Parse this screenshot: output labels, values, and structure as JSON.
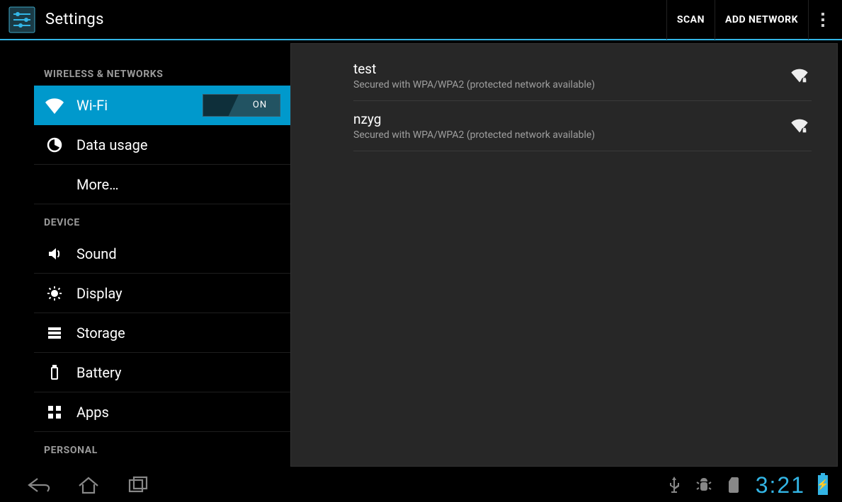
{
  "actionbar": {
    "title": "Settings",
    "scan": "SCAN",
    "add_network": "ADD NETWORK"
  },
  "sidebar": {
    "cat_wireless": "WIRELESS & NETWORKS",
    "cat_device": "DEVICE",
    "cat_personal": "PERSONAL",
    "wifi": "Wi-Fi",
    "wifi_toggle": "ON",
    "data_usage": "Data usage",
    "more": "More…",
    "sound": "Sound",
    "display": "Display",
    "storage": "Storage",
    "battery": "Battery",
    "apps": "Apps"
  },
  "networks": [
    {
      "name": "test",
      "desc": "Secured with WPA/WPA2 (protected network available)"
    },
    {
      "name": "nzyg",
      "desc": "Secured with WPA/WPA2 (protected network available)"
    }
  ],
  "sysbar": {
    "clock": "3:21"
  }
}
